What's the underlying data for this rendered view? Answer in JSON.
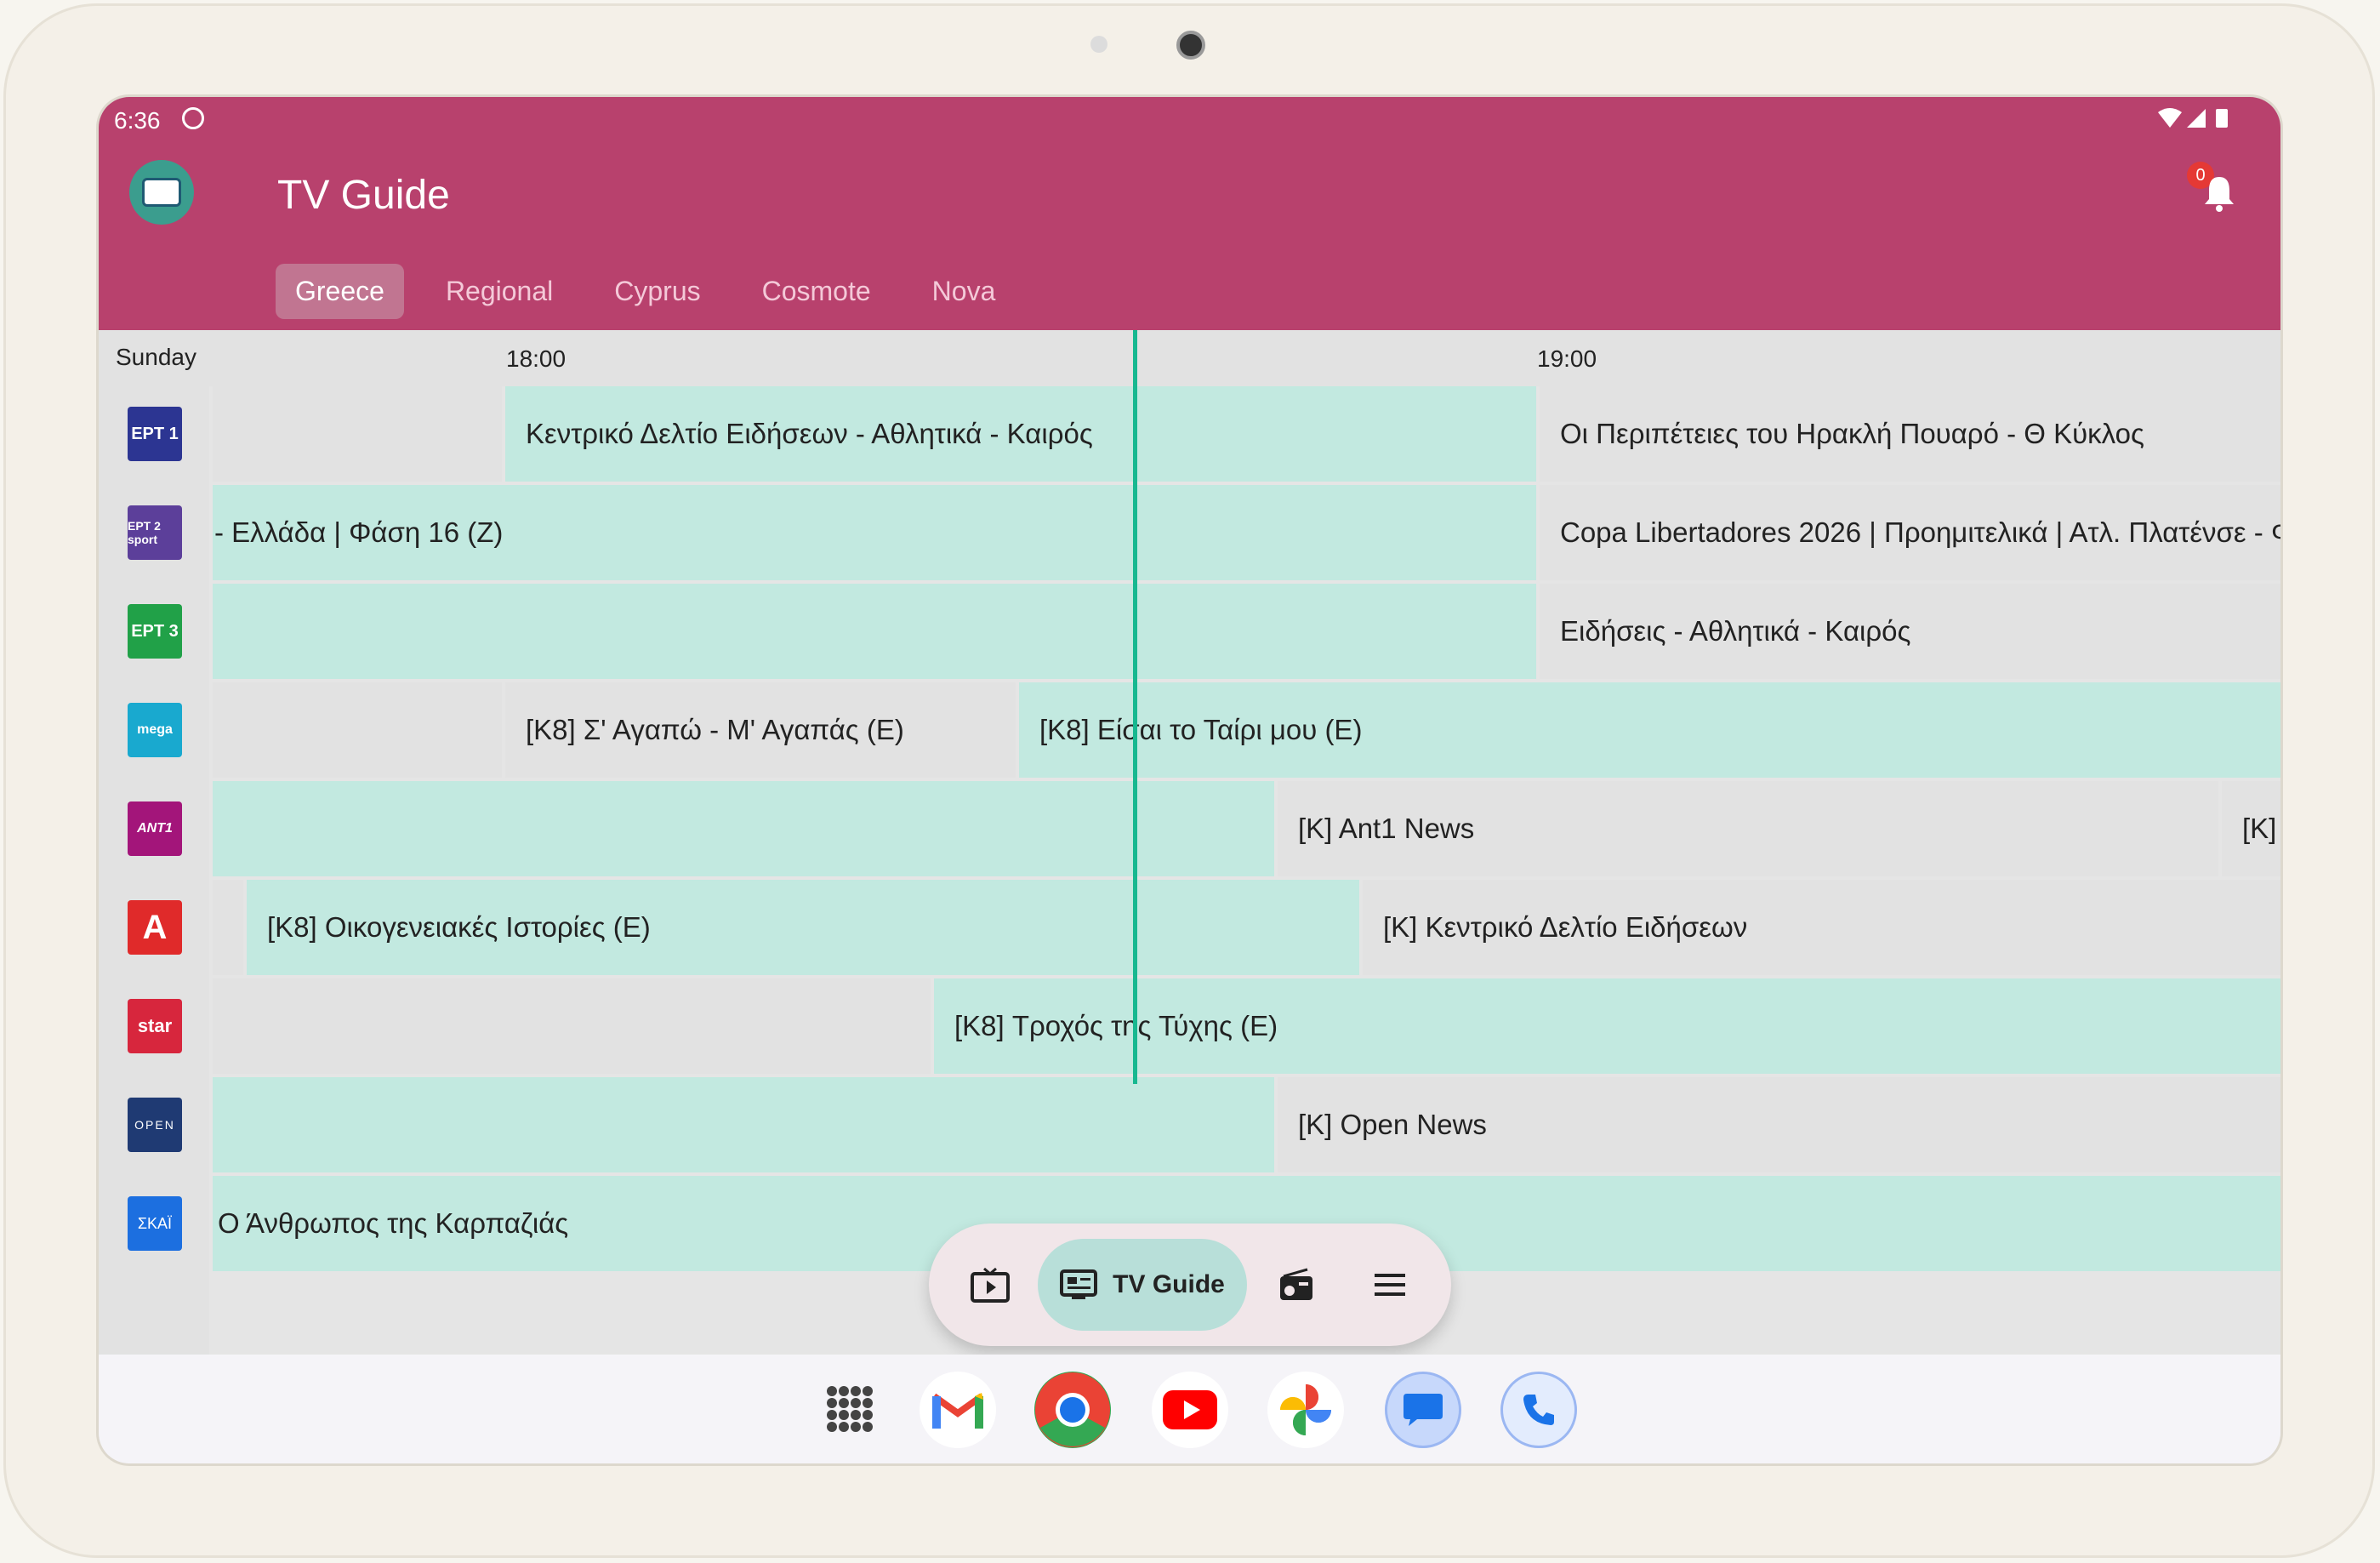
{
  "status_bar": {
    "time": "6:36",
    "icons": "▼◢▮"
  },
  "app": {
    "title": "TV Guide",
    "notification_count": "0"
  },
  "tabs": [
    {
      "label": "Greece",
      "active": true
    },
    {
      "label": "Regional"
    },
    {
      "label": "Cyprus"
    },
    {
      "label": "Cosmote"
    },
    {
      "label": "Nova"
    }
  ],
  "guide": {
    "day": "Sunday",
    "ticks": [
      "18:00",
      "19:00"
    ],
    "channels": [
      {
        "logo": "ΕΡΤ 1",
        "color": "#2c3592",
        "programs": [
          "",
          "Κεντρικό Δελτίο Ειδήσεων - Αθλητικά - Καιρός",
          "Οι Περιπέτειες του Ηρακλή Πουαρό - Θ Κύκλος"
        ]
      },
      {
        "logo": "ΕΡΤ 2 sport",
        "color": "#5c3f9a",
        "programs": [
          "- Ελλάδα | Φάση 16 (Ζ)",
          "Copa Libertadores 2026 | Προημιτελικά | Ατλ. Πλατένσε - Φ"
        ]
      },
      {
        "logo": "ΕΡΤ 3",
        "color": "#21a148",
        "programs": [
          "",
          "Ειδήσεις - Αθλητικά - Καιρός"
        ]
      },
      {
        "logo": "mega",
        "color": "#19a9cf",
        "programs": [
          "",
          "[K8] Σ' Αγαπώ - Μ' Αγαπάς (E)",
          "[K8] Είσαι το Ταίρι μου (E)"
        ]
      },
      {
        "logo": "ANT1",
        "color": "#a3157a",
        "programs": [
          "",
          "[K] Ant1 News",
          "[K]"
        ]
      },
      {
        "logo": "A",
        "color": "#e02a2a",
        "programs": [
          "",
          "[K8] Οικογενειακές Ιστορίες (E)",
          "[K] Κεντρικό Δελτίο Ειδήσεων"
        ]
      },
      {
        "logo": "star",
        "color": "#d7263d",
        "programs": [
          "",
          "[K8] Τροχός της Τύχης (E)"
        ]
      },
      {
        "logo": "OPEN",
        "color": "#1f3a73",
        "programs": [
          "",
          "[K] Open News"
        ]
      },
      {
        "logo": "ΣΚΑΪ",
        "color": "#1c6fe0",
        "programs": [
          "Ο Άνθρωπος της Καρπαζιάς"
        ]
      }
    ]
  },
  "bottom_nav": {
    "items": [
      {
        "icon": "live-tv-icon"
      },
      {
        "icon": "tv-guide-icon",
        "label": "TV Guide",
        "active": true
      },
      {
        "icon": "radio-icon"
      },
      {
        "icon": "menu-icon"
      }
    ]
  },
  "dock": [
    "app-drawer-icon",
    "gmail-icon",
    "chrome-icon",
    "youtube-icon",
    "photos-icon",
    "messages-icon",
    "phone-icon"
  ]
}
